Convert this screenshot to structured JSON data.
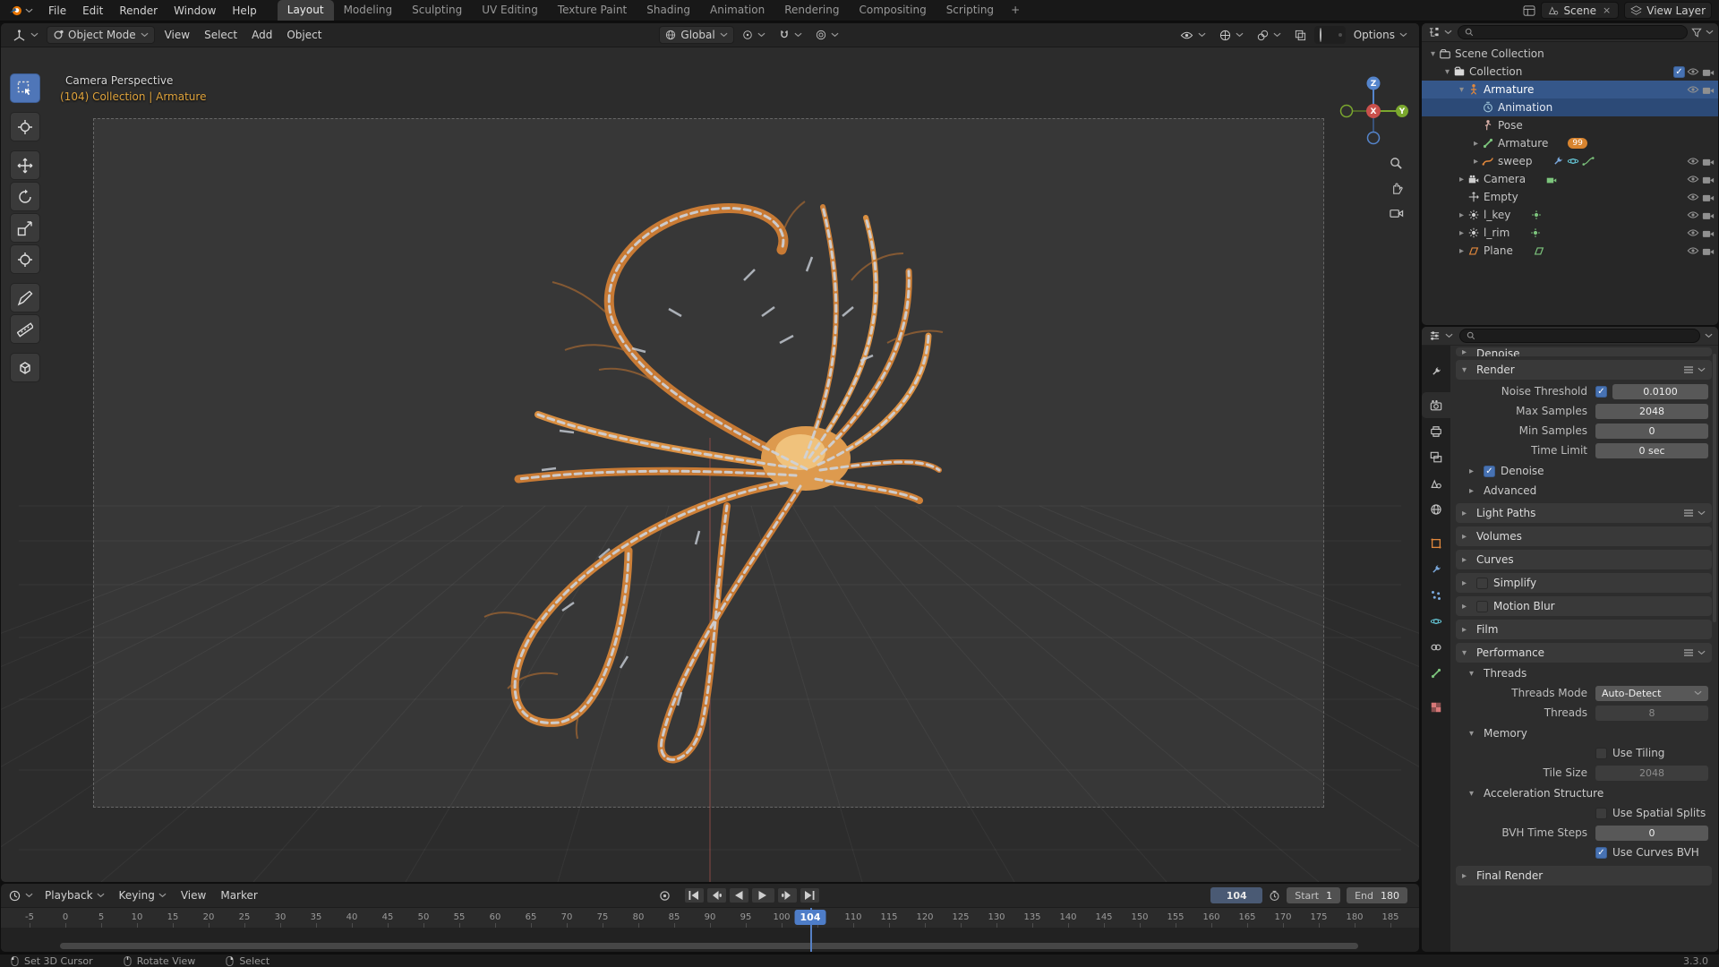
{
  "app": {
    "version_label": "3.3.0",
    "accent_color": "#4772b3",
    "selection_color": "#35578a",
    "object_color": "#e0873c"
  },
  "topbar": {
    "menus": [
      "File",
      "Edit",
      "Render",
      "Window",
      "Help"
    ],
    "workspaces": [
      "Layout",
      "Modeling",
      "Sculpting",
      "UV Editing",
      "Texture Paint",
      "Shading",
      "Animation",
      "Rendering",
      "Compositing",
      "Scripting"
    ],
    "active_workspace": "Layout",
    "new_workspace_label": "+",
    "scene_label": "Scene",
    "view_layer_label": "View Layer",
    "scene_close_label": "×"
  },
  "viewport_header": {
    "mode_label": "Object Mode",
    "menus": [
      "View",
      "Select",
      "Add",
      "Object"
    ],
    "orientation_label": "Global",
    "options_label": "Options"
  },
  "viewport": {
    "view_label": "Camera Perspective",
    "context_label": "(104) Collection | Armature",
    "gizmo_axes": {
      "x": "X",
      "y": "Y",
      "z": "Z"
    },
    "tools": [
      "select-box",
      "cursor",
      "move",
      "rotate",
      "scale",
      "transform",
      "annotate",
      "measure",
      "add-cube"
    ]
  },
  "outliner": {
    "search_placeholder": "",
    "rows": [
      {
        "label": "Scene Collection",
        "icon": "scene-collection",
        "depth": 0,
        "disclosure": "open"
      },
      {
        "label": "Collection",
        "icon": "collection",
        "depth": 1,
        "disclosure": "open",
        "checkbox": true,
        "eye": true,
        "cam": true
      },
      {
        "label": "Armature",
        "icon": "armature",
        "depth": 2,
        "disclosure": "open",
        "state": "active",
        "eye": true,
        "cam": true
      },
      {
        "label": "Animation",
        "icon": "action",
        "depth": 3,
        "state": "selected"
      },
      {
        "label": "Pose",
        "icon": "pose",
        "depth": 3
      },
      {
        "label": "Armature",
        "icon": "armature-data",
        "depth": 3,
        "disclosure": "closed",
        "badge": "99"
      },
      {
        "label": "sweep",
        "icon": "sweep",
        "depth": 3,
        "disclosure": "closed",
        "data_icons": [
          "wrench",
          "physics",
          "curve"
        ],
        "eye": true,
        "cam": true
      },
      {
        "label": "Camera",
        "icon": "camera",
        "depth": 2,
        "disclosure": "closed",
        "data_icons": [
          "camera-data"
        ],
        "eye": true,
        "cam": true
      },
      {
        "label": "Empty",
        "icon": "empty",
        "depth": 2,
        "eye": true,
        "cam": true
      },
      {
        "label": "l_key",
        "icon": "light",
        "depth": 2,
        "disclosure": "closed",
        "data_icons": [
          "light-data"
        ],
        "eye": true,
        "cam": true
      },
      {
        "label": "l_rim",
        "icon": "light",
        "depth": 2,
        "disclosure": "closed",
        "data_icons": [
          "light-data"
        ],
        "eye": true,
        "cam": true
      },
      {
        "label": "Plane",
        "icon": "mesh",
        "depth": 2,
        "disclosure": "closed",
        "data_icons": [
          "mesh-data"
        ],
        "eye": true,
        "cam": true
      }
    ]
  },
  "properties": {
    "search_placeholder": "",
    "tabs": [
      {
        "name": "tool"
      },
      {
        "name": "render",
        "active": true
      },
      {
        "name": "output"
      },
      {
        "name": "view-layer"
      },
      {
        "name": "scene"
      },
      {
        "name": "world"
      },
      {
        "name": "object"
      },
      {
        "name": "modifiers"
      },
      {
        "name": "particles"
      },
      {
        "name": "physics"
      },
      {
        "name": "constraints"
      },
      {
        "name": "data"
      },
      {
        "name": "texture"
      }
    ],
    "rows": [
      {
        "type": "section",
        "label": "Denoise",
        "clipped": true
      },
      {
        "type": "section",
        "label": "Render",
        "open": true,
        "menu": true
      },
      {
        "type": "field",
        "label": "Noise Threshold",
        "checkbox": true,
        "checked": true,
        "value": "0.0100"
      },
      {
        "type": "field",
        "label": "Max Samples",
        "value": "2048"
      },
      {
        "type": "field",
        "label": "Min Samples",
        "value": "0"
      },
      {
        "type": "field",
        "label": "Time Limit",
        "value": "0 sec"
      },
      {
        "type": "subsection",
        "label": "Denoise",
        "checkbox": true,
        "checked": true
      },
      {
        "type": "subsection",
        "label": "Advanced"
      },
      {
        "type": "section",
        "label": "Light Paths",
        "menu": true
      },
      {
        "type": "section",
        "label": "Volumes"
      },
      {
        "type": "section",
        "label": "Curves"
      },
      {
        "type": "section",
        "label": "Simplify",
        "checkbox": true,
        "checked": false
      },
      {
        "type": "section",
        "label": "Motion Blur",
        "checkbox": true,
        "checked": false
      },
      {
        "type": "section",
        "label": "Film"
      },
      {
        "type": "section",
        "label": "Performance",
        "open": true,
        "menu": true
      },
      {
        "type": "subsection",
        "label": "Threads",
        "open": true
      },
      {
        "type": "field",
        "label": "Threads Mode",
        "value": "Auto-Detect",
        "dropdown": true
      },
      {
        "type": "field",
        "label": "Threads",
        "value": "8",
        "disabled": true
      },
      {
        "type": "subsection",
        "label": "Memory",
        "open": true
      },
      {
        "type": "field",
        "checkbox_label": "Use Tiling",
        "checked": false
      },
      {
        "type": "field",
        "label": "Tile Size",
        "value": "2048",
        "disabled": true
      },
      {
        "type": "subsection",
        "label": "Acceleration Structure",
        "open": true
      },
      {
        "type": "field",
        "checkbox_label": "Use Spatial Splits",
        "checked": false
      },
      {
        "type": "field",
        "label": "BVH Time Steps",
        "value": "0"
      },
      {
        "type": "field",
        "checkbox_label": "Use Curves BVH",
        "checked": true
      },
      {
        "type": "section",
        "label": "Final Render"
      }
    ]
  },
  "timeline": {
    "menus": [
      "Playback",
      "Keying",
      "View",
      "Marker"
    ],
    "transport": [
      "jump-start",
      "prev-keyframe",
      "play-reverse",
      "play",
      "next-keyframe",
      "jump-end"
    ],
    "current_frame": "104",
    "frame_start_label": "Start",
    "frame_start": "1",
    "frame_end_label": "End",
    "frame_end": "180",
    "tick_start": -5,
    "tick_end": 185,
    "tick_step": 5,
    "playhead_frame": 104
  },
  "statusbar": {
    "hints": [
      {
        "mouse": "left",
        "label": "Set 3D Cursor"
      },
      {
        "mouse": "middle",
        "label": "Rotate View"
      },
      {
        "mouse": "right",
        "label": "Select"
      }
    ],
    "version": "3.3.0"
  }
}
